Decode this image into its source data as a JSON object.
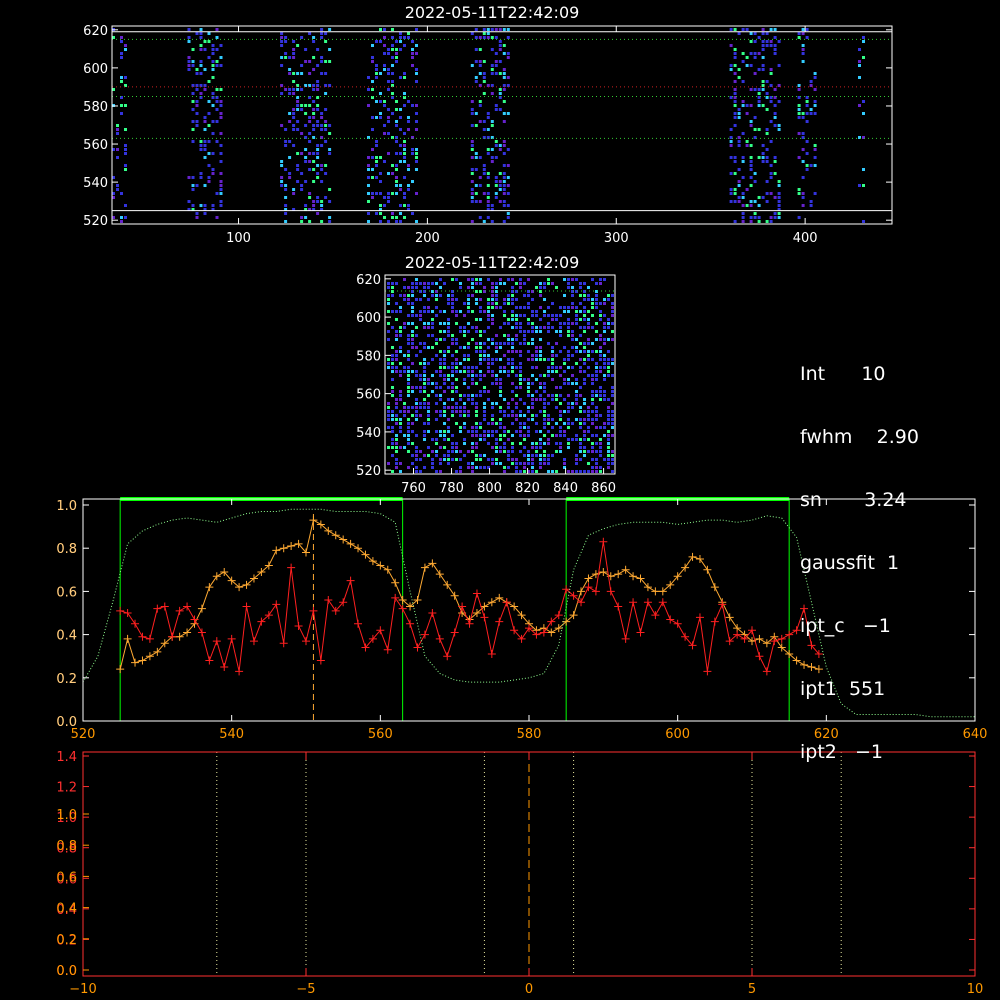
{
  "colors": {
    "white": "#ffffff",
    "green": "#00ff00",
    "red": "#ff2020",
    "orange": "#ffaa33",
    "pale_green": "#90ff90",
    "axis_red": "#ff3030",
    "axis_orange": "#ff9900",
    "heat_blue": "#3333dd",
    "heat_cyan": "#33ccff",
    "heat_green": "#33ff88",
    "heat_purple": "#6622cc"
  },
  "top_panel": {
    "title": "2022-05-11T22:42:09",
    "xlim": [
      33,
      446
    ],
    "ylim": [
      518,
      622
    ],
    "xticks": [
      "100",
      "200",
      "300",
      "400"
    ],
    "xtick_values": [
      100,
      200,
      300,
      400
    ],
    "yticks": [
      "520",
      "540",
      "560",
      "580",
      "600",
      "620"
    ],
    "ytick_values": [
      520,
      540,
      560,
      580,
      600,
      620
    ],
    "hlines_white": [
      525,
      619
    ],
    "hlines_green_dotted": [
      563,
      585,
      615
    ],
    "hline_red_dotted": 590,
    "bands": [
      [
        33,
        40
      ],
      [
        73,
        90
      ],
      [
        122,
        148
      ],
      [
        168,
        195
      ],
      [
        223,
        244
      ],
      [
        360,
        386
      ],
      [
        396,
        405
      ],
      [
        428,
        432
      ]
    ]
  },
  "mid_panel": {
    "title": "2022-05-11T22:42:09",
    "xlim": [
      745,
      866
    ],
    "ylim": [
      518,
      622
    ],
    "xticks": [
      "760",
      "780",
      "800",
      "820",
      "840",
      "860"
    ],
    "xtick_values": [
      760,
      780,
      800,
      820,
      840,
      860
    ],
    "yticks": [
      "520",
      "540",
      "560",
      "580",
      "600",
      "620"
    ],
    "ytick_values": [
      520,
      540,
      560,
      580,
      600,
      620
    ]
  },
  "info": {
    "int": "Int      10",
    "fwhm": "fwhm    2.90",
    "sn": "sn       3.24",
    "gaussfit": "gaussfit  1",
    "ipt_c": "ipt_c   −1",
    "ipt1": "ipt1  551",
    "ipt2": "ipt2   −1"
  },
  "chart_data": [
    {
      "type": "line",
      "panel": "spectrum",
      "xlim": [
        520,
        640
      ],
      "ylim": [
        0,
        1.0
      ],
      "xticks": [
        "520",
        "540",
        "560",
        "580",
        "600",
        "620",
        "640"
      ],
      "xtick_values": [
        520,
        540,
        560,
        580,
        600,
        620,
        640
      ],
      "yticks": [
        "0.0",
        "0.2",
        "0.4",
        "0.6",
        "0.8",
        "1.0"
      ],
      "ytick_values": [
        0,
        0.2,
        0.4,
        0.6,
        0.8,
        1.0
      ],
      "yticks_overlay": [
        "0.0",
        "0.2",
        "0.4",
        "0.6",
        "0.8",
        "1.0"
      ],
      "vlines_green": [
        525,
        563,
        585,
        615
      ],
      "green_bars": [
        [
          525,
          563
        ],
        [
          585,
          615
        ]
      ],
      "vline_dashed": 551,
      "series": [
        {
          "color": "orange",
          "x": [
            525,
            526,
            527,
            528,
            529,
            530,
            531,
            532,
            533,
            534,
            535,
            536,
            537,
            538,
            539,
            540,
            541,
            542,
            543,
            544,
            545,
            546,
            547,
            548,
            549,
            550,
            551,
            552,
            553,
            554,
            555,
            556,
            557,
            558,
            559,
            560,
            561,
            562,
            563,
            564,
            565,
            566,
            567,
            568,
            569,
            570,
            571,
            572,
            573,
            574,
            575,
            576,
            577,
            578,
            579,
            580,
            581,
            582,
            583,
            584,
            585,
            586,
            587,
            588,
            589,
            590,
            591,
            592,
            593,
            594,
            595,
            596,
            597,
            598,
            599,
            600,
            601,
            602,
            603,
            604,
            605,
            606,
            607,
            608,
            609,
            610,
            611,
            612,
            613,
            614,
            615,
            616,
            617,
            618,
            619
          ],
          "y": [
            0.24,
            0.38,
            0.27,
            0.28,
            0.3,
            0.32,
            0.36,
            0.39,
            0.39,
            0.41,
            0.45,
            0.52,
            0.62,
            0.67,
            0.69,
            0.65,
            0.62,
            0.63,
            0.66,
            0.69,
            0.72,
            0.79,
            0.8,
            0.81,
            0.82,
            0.78,
            0.93,
            0.91,
            0.88,
            0.86,
            0.84,
            0.82,
            0.8,
            0.77,
            0.74,
            0.72,
            0.7,
            0.64,
            0.56,
            0.53,
            0.56,
            0.71,
            0.73,
            0.68,
            0.63,
            0.58,
            0.5,
            0.47,
            0.5,
            0.53,
            0.55,
            0.57,
            0.55,
            0.53,
            0.49,
            0.45,
            0.42,
            0.43,
            0.41,
            0.43,
            0.46,
            0.49,
            0.6,
            0.66,
            0.68,
            0.69,
            0.67,
            0.68,
            0.7,
            0.67,
            0.66,
            0.62,
            0.6,
            0.6,
            0.63,
            0.67,
            0.71,
            0.76,
            0.75,
            0.7,
            0.62,
            0.55,
            0.48,
            0.43,
            0.4,
            0.37,
            0.38,
            0.36,
            0.39,
            0.34,
            0.31,
            0.28,
            0.26,
            0.25,
            0.24
          ]
        },
        {
          "color": "red",
          "x": [
            525,
            526,
            527,
            528,
            529,
            530,
            531,
            532,
            533,
            534,
            535,
            536,
            537,
            538,
            539,
            540,
            541,
            542,
            543,
            544,
            545,
            546,
            547,
            548,
            549,
            550,
            551,
            552,
            553,
            554,
            555,
            556,
            557,
            558,
            559,
            560,
            561,
            562,
            563,
            564,
            565,
            566,
            567,
            568,
            569,
            570,
            571,
            572,
            573,
            574,
            575,
            576,
            577,
            578,
            579,
            580,
            581,
            582,
            583,
            584,
            585,
            586,
            587,
            588,
            589,
            590,
            591,
            592,
            593,
            594,
            595,
            596,
            597,
            598,
            599,
            600,
            601,
            602,
            603,
            604,
            605,
            606,
            607,
            608,
            609,
            610,
            611,
            612,
            613,
            614,
            615,
            616,
            617,
            618,
            619
          ],
          "y": [
            0.51,
            0.5,
            0.45,
            0.39,
            0.38,
            0.52,
            0.53,
            0.39,
            0.51,
            0.53,
            0.47,
            0.41,
            0.28,
            0.37,
            0.25,
            0.38,
            0.23,
            0.53,
            0.37,
            0.46,
            0.49,
            0.54,
            0.36,
            0.71,
            0.44,
            0.37,
            0.51,
            0.28,
            0.56,
            0.51,
            0.55,
            0.65,
            0.45,
            0.34,
            0.38,
            0.42,
            0.33,
            0.57,
            0.52,
            0.45,
            0.34,
            0.4,
            0.5,
            0.38,
            0.3,
            0.41,
            0.53,
            0.45,
            0.59,
            0.48,
            0.31,
            0.46,
            0.55,
            0.42,
            0.38,
            0.43,
            0.4,
            0.41,
            0.46,
            0.49,
            0.61,
            0.58,
            0.55,
            0.62,
            0.6,
            0.83,
            0.6,
            0.53,
            0.38,
            0.55,
            0.41,
            0.55,
            0.49,
            0.55,
            0.47,
            0.45,
            0.39,
            0.35,
            0.48,
            0.23,
            0.46,
            0.54,
            0.37,
            0.4,
            0.38,
            0.42,
            0.3,
            0.23,
            0.37,
            0.38,
            0.4,
            0.42,
            0.52,
            0.35,
            0.31
          ]
        },
        {
          "color": "pale_green",
          "style": "dotted",
          "x": [
            520,
            522,
            524,
            526,
            528,
            530,
            532,
            534,
            536,
            538,
            540,
            542,
            544,
            546,
            548,
            550,
            552,
            554,
            556,
            558,
            560,
            562,
            564,
            566,
            568,
            570,
            572,
            574,
            576,
            578,
            580,
            582,
            584,
            586,
            588,
            590,
            592,
            594,
            596,
            598,
            600,
            602,
            604,
            606,
            608,
            610,
            612,
            614,
            616,
            618,
            620,
            622,
            624,
            626,
            628,
            630,
            632,
            634,
            636,
            638,
            640
          ],
          "y": [
            0.18,
            0.3,
            0.55,
            0.82,
            0.88,
            0.91,
            0.93,
            0.94,
            0.93,
            0.92,
            0.94,
            0.96,
            0.97,
            0.97,
            0.98,
            0.98,
            0.98,
            0.97,
            0.97,
            0.97,
            0.96,
            0.92,
            0.6,
            0.3,
            0.22,
            0.19,
            0.18,
            0.18,
            0.18,
            0.19,
            0.2,
            0.22,
            0.35,
            0.7,
            0.86,
            0.89,
            0.91,
            0.92,
            0.92,
            0.92,
            0.91,
            0.92,
            0.93,
            0.93,
            0.92,
            0.93,
            0.95,
            0.94,
            0.85,
            0.55,
            0.25,
            0.08,
            0.03,
            0.03,
            0.03,
            0.03,
            0.03,
            0.02,
            0.02,
            0.02,
            0.02
          ]
        }
      ]
    },
    {
      "type": "line",
      "panel": "bottom",
      "xlim": [
        -10,
        10
      ],
      "ylim": [
        0,
        1.0
      ],
      "xticks": [
        "−10",
        "−5",
        "0",
        "5",
        "10"
      ],
      "xtick_values": [
        -10,
        -5,
        0,
        5,
        10
      ],
      "yticks_a": [
        "0.0",
        "0.2",
        "0.4",
        "0.6",
        "0.8",
        "1.0",
        "1.2",
        "1.4"
      ],
      "yticks_b": [
        "0.0",
        "0.2",
        "0.4",
        "0.6",
        "0.8",
        "1.0"
      ],
      "vlines_dotted": [
        -7,
        -5,
        -1,
        1,
        5,
        7
      ],
      "vline_dashed": 0
    }
  ]
}
